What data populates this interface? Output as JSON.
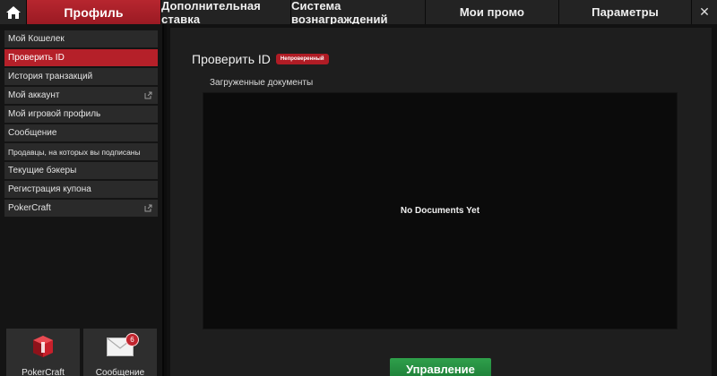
{
  "nav": {
    "tabs": [
      {
        "label": "Профиль"
      },
      {
        "label": "Дополнительная ставка"
      },
      {
        "label": "Система вознаграждений"
      },
      {
        "label": "Мои промо"
      },
      {
        "label": "Параметры"
      }
    ],
    "close_glyph": "✕"
  },
  "sidebar": {
    "items": [
      {
        "label": "Мой Кошелек"
      },
      {
        "label": "Проверить ID"
      },
      {
        "label": "История транзакций"
      },
      {
        "label": "Мой аккаунт"
      },
      {
        "label": "Мой игровой профиль"
      },
      {
        "label": "Сообщение"
      },
      {
        "label": "Продавцы, на которых вы подписаны"
      },
      {
        "label": "Текущие бэкеры"
      },
      {
        "label": "Регистрация купона"
      },
      {
        "label": "PokerCraft"
      }
    ],
    "tiles": [
      {
        "label": "PokerCraft"
      },
      {
        "label": "Сообщение",
        "badge": "6"
      }
    ]
  },
  "main": {
    "title": "Проверить ID",
    "status_badge": "Непроверенный",
    "subtitle": "Загруженные документы",
    "empty_text": "No Documents Yet",
    "manage_button": "Управление"
  },
  "colors": {
    "accent_red": "#b52029",
    "button_green": "#2fa04b"
  }
}
